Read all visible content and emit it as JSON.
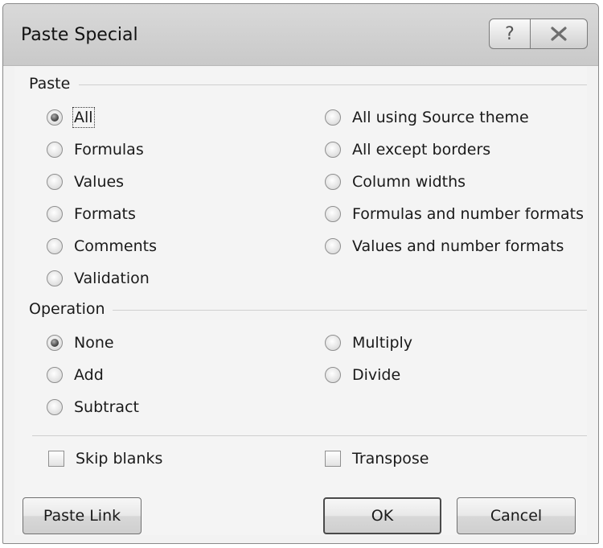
{
  "window": {
    "title": "Paste Special",
    "help_glyph": "?",
    "close_glyph": "✕"
  },
  "paste": {
    "label": "Paste",
    "left_options": [
      {
        "label": "All",
        "checked": true
      },
      {
        "label": "Formulas",
        "checked": false
      },
      {
        "label": "Values",
        "checked": false
      },
      {
        "label": "Formats",
        "checked": false
      },
      {
        "label": "Comments",
        "checked": false
      },
      {
        "label": "Validation",
        "checked": false
      }
    ],
    "right_options": [
      {
        "label": "All using Source theme",
        "checked": false
      },
      {
        "label": "All except borders",
        "checked": false
      },
      {
        "label": "Column widths",
        "checked": false
      },
      {
        "label": "Formulas and number formats",
        "checked": false
      },
      {
        "label": "Values and number formats",
        "checked": false
      }
    ]
  },
  "operation": {
    "label": "Operation",
    "left_options": [
      {
        "label": "None",
        "checked": true
      },
      {
        "label": "Add",
        "checked": false
      },
      {
        "label": "Subtract",
        "checked": false
      }
    ],
    "right_options": [
      {
        "label": "Multiply",
        "checked": false
      },
      {
        "label": "Divide",
        "checked": false
      }
    ]
  },
  "checkboxes": {
    "skip_blanks": {
      "label": "Skip blanks",
      "checked": false
    },
    "transpose": {
      "label": "Transpose",
      "checked": false
    }
  },
  "buttons": {
    "paste_link": "Paste Link",
    "ok": "OK",
    "cancel": "Cancel"
  }
}
